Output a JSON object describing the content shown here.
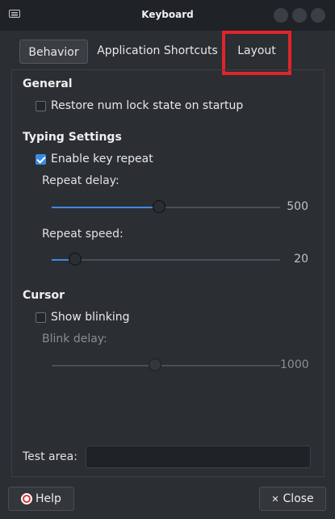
{
  "window": {
    "title": "Keyboard"
  },
  "tabs": [
    {
      "label": "Behavior"
    },
    {
      "label": "Application Shortcuts"
    },
    {
      "label": "Layout"
    }
  ],
  "general": {
    "title": "General",
    "restore_numlock_label": "Restore num lock state on startup",
    "restore_numlock_checked": false
  },
  "typing": {
    "title": "Typing Settings",
    "enable_repeat_label": "Enable key repeat",
    "enable_repeat_checked": true,
    "repeat_delay_label": "Repeat delay:",
    "repeat_delay_value": "500",
    "repeat_delay_fraction": 0.47,
    "repeat_speed_label": "Repeat speed:",
    "repeat_speed_value": "20",
    "repeat_speed_fraction": 0.08
  },
  "cursor": {
    "title": "Cursor",
    "show_blinking_label": "Show blinking",
    "show_blinking_checked": false,
    "blink_delay_label": "Blink delay:",
    "blink_delay_value": "1000",
    "blink_delay_fraction": 0.45
  },
  "test_area": {
    "label": "Test area:",
    "value": ""
  },
  "buttons": {
    "help": "Help",
    "close": "Close"
  },
  "colors": {
    "accent": "#3d8be0",
    "highlight": "#e0252a"
  }
}
